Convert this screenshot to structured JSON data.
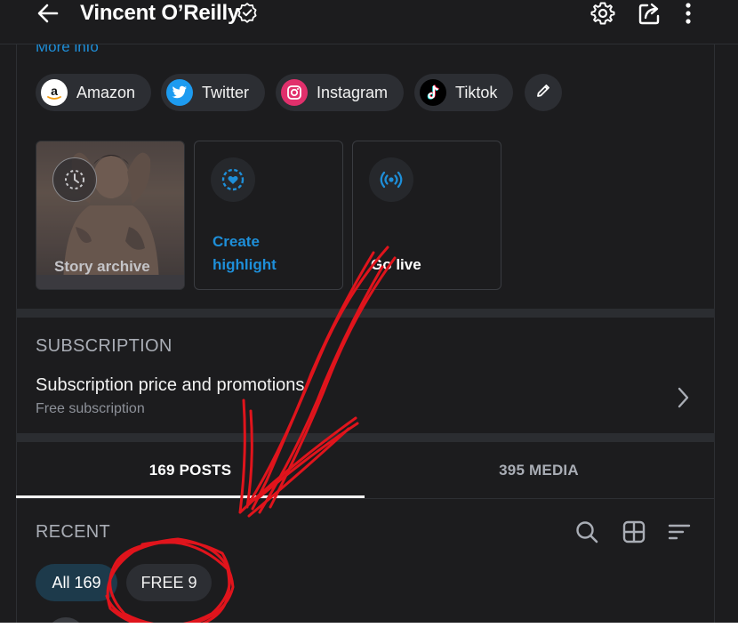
{
  "header": {
    "title": "Vincent O’Reilly",
    "back_icon": "arrow-left-icon",
    "verified_icon": "verified-badge-icon",
    "actions": [
      "gear-icon",
      "share-icon",
      "more-vertical-icon"
    ]
  },
  "profile": {
    "more_info": "More info",
    "social_links": [
      {
        "label": "Amazon",
        "icon": "amazon-icon",
        "color": "#ffffff"
      },
      {
        "label": "Twitter",
        "icon": "twitter-bird-icon",
        "color": "#1d9bf0"
      },
      {
        "label": "Instagram",
        "icon": "instagram-icon",
        "color": "#e1306c"
      },
      {
        "label": "Tiktok",
        "icon": "tiktok-icon",
        "color": "#000000"
      }
    ],
    "edit_icon": "pencil-icon"
  },
  "story_cards": [
    {
      "label": "Story archive",
      "icon": "clock-history-icon"
    },
    {
      "label_line1": "Create",
      "label_line2": "highlight",
      "icon": "heart-circle-icon"
    },
    {
      "label": "Go live",
      "icon": "broadcast-icon"
    }
  ],
  "subscription": {
    "heading": "SUBSCRIPTION",
    "title": "Subscription price and promotions",
    "caption": "Free subscription",
    "chevron_icon": "chevron-right-icon"
  },
  "tabs": [
    {
      "label": "169 POSTS",
      "active": true
    },
    {
      "label": "395 MEDIA",
      "active": false
    }
  ],
  "feed": {
    "heading": "RECENT",
    "tools": [
      "search-icon",
      "grid-icon",
      "sort-icon"
    ],
    "filters": [
      {
        "label": "All 169",
        "active": true
      },
      {
        "label": "FREE 9",
        "active": false
      }
    ]
  },
  "colors": {
    "background": "#1c1c1e",
    "accent": "#1e8fd9",
    "annotation": "#e0141c",
    "chip": "#2c2e33",
    "active_pill": "#1d3a4b"
  }
}
